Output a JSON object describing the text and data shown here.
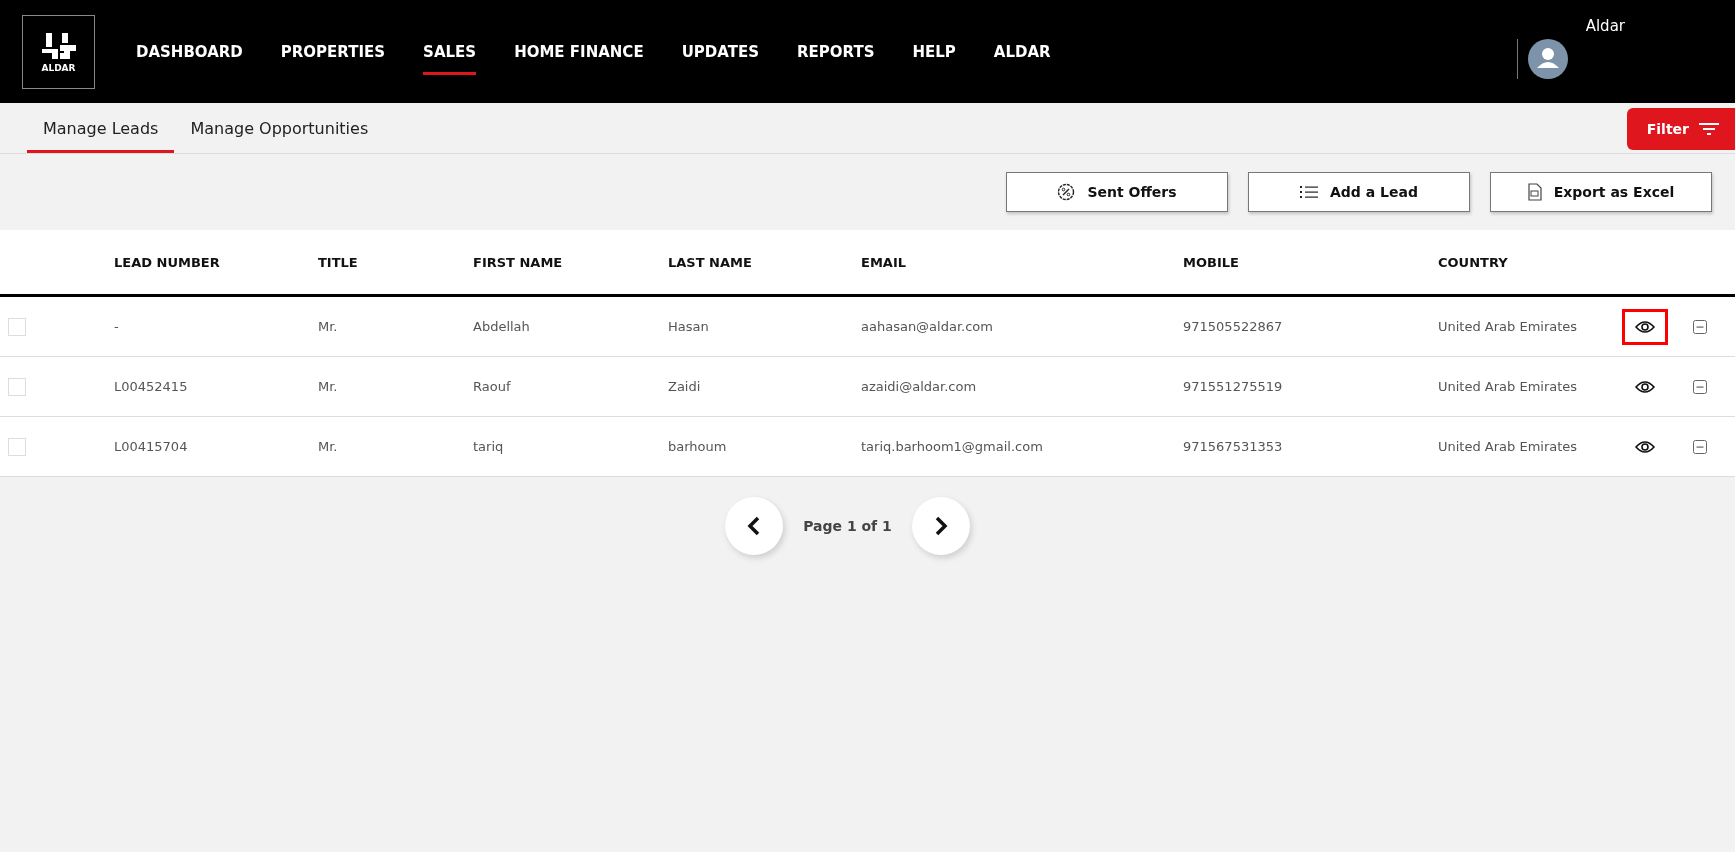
{
  "brand": {
    "logo_text": "ALDAR"
  },
  "nav": [
    {
      "label": "DASHBOARD",
      "selected": false
    },
    {
      "label": "PROPERTIES",
      "selected": false
    },
    {
      "label": "SALES",
      "selected": true
    },
    {
      "label": "HOME FINANCE",
      "selected": false
    },
    {
      "label": "UPDATES",
      "selected": false
    },
    {
      "label": "REPORTS",
      "selected": false
    },
    {
      "label": "HELP",
      "selected": false
    },
    {
      "label": "ALDAR",
      "selected": false
    }
  ],
  "user": {
    "name": "Aldar"
  },
  "tabs": [
    {
      "label": "Manage Leads",
      "selected": true
    },
    {
      "label": "Manage Opportunities",
      "selected": false
    }
  ],
  "filter_button": "Filter",
  "actions": [
    {
      "kind": "offers",
      "label": "Sent Offers"
    },
    {
      "kind": "list",
      "label": "Add a Lead"
    },
    {
      "kind": "excel",
      "label": "Export as Excel"
    }
  ],
  "table": {
    "columns": [
      "LEAD NUMBER",
      "TITLE",
      "FIRST NAME",
      "LAST NAME",
      "EMAIL",
      "MOBILE",
      "COUNTRY"
    ],
    "rows": [
      {
        "checked": false,
        "highlighted": true,
        "cells": [
          "-",
          "Mr.",
          "Abdellah",
          "Hasan",
          "aahasan@aldar.com",
          "971505522867",
          "United Arab Emirates"
        ]
      },
      {
        "checked": false,
        "highlighted": false,
        "cells": [
          "L00452415",
          "Mr.",
          "Raouf",
          "Zaidi",
          "azaidi@aldar.com",
          "971551275519",
          "United Arab Emirates"
        ]
      },
      {
        "checked": false,
        "highlighted": false,
        "cells": [
          "L00415704",
          "Mr.",
          "tariq",
          "barhoum",
          "tariq.barhoom1@gmail.com",
          "971567531353",
          "United Arab Emirates"
        ]
      }
    ]
  },
  "pagination": {
    "label": "Page 1 of 1"
  }
}
